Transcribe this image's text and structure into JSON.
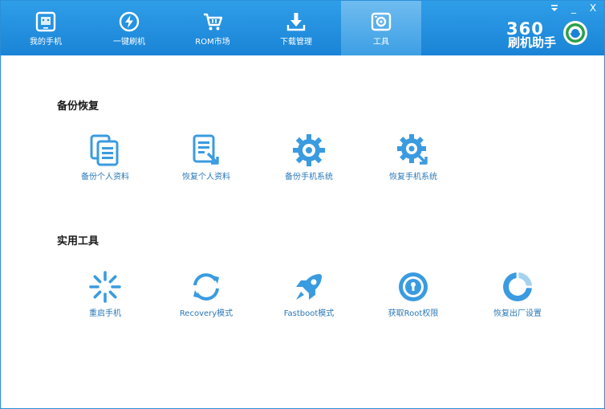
{
  "nav": {
    "tabs": [
      {
        "label": "我的手机",
        "icon": "phone-icon"
      },
      {
        "label": "一键刷机",
        "icon": "flash-icon"
      },
      {
        "label": "ROM市场",
        "icon": "cart-icon"
      },
      {
        "label": "下载管理",
        "icon": "download-icon"
      },
      {
        "label": "工具",
        "icon": "toolbox-icon",
        "active": true
      }
    ]
  },
  "window_controls": {
    "menu": "menu-icon",
    "minimize": "_",
    "close": "X"
  },
  "brand": {
    "number": "360",
    "name": "刷机助手"
  },
  "sections": {
    "backup": {
      "title": "备份恢复",
      "items": [
        {
          "label": "备份个人资料",
          "icon": "backup-data-icon"
        },
        {
          "label": "恢复个人资料",
          "icon": "restore-data-icon"
        },
        {
          "label": "备份手机系统",
          "icon": "backup-system-icon"
        },
        {
          "label": "恢复手机系统",
          "icon": "restore-system-icon"
        }
      ]
    },
    "tools": {
      "title": "实用工具",
      "items": [
        {
          "label": "重启手机",
          "icon": "reboot-icon"
        },
        {
          "label": "Recovery模式",
          "icon": "recovery-icon"
        },
        {
          "label": "Fastboot模式",
          "icon": "rocket-icon"
        },
        {
          "label": "获取Root权限",
          "icon": "root-lock-icon"
        },
        {
          "label": "恢复出厂设置",
          "icon": "factory-reset-icon"
        }
      ]
    }
  },
  "colors": {
    "topbar": "#1a83d6",
    "icon": "#3a9be0",
    "label": "#2a78b8"
  }
}
